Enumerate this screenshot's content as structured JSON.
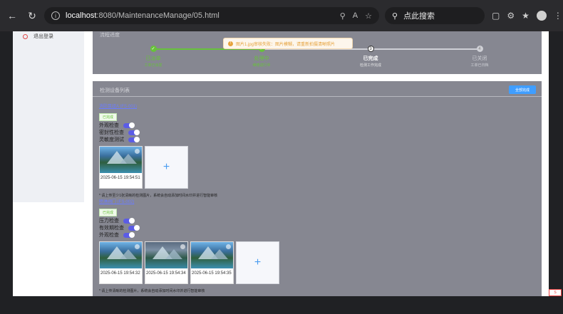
{
  "browser": {
    "url_host": "localhost",
    "url_path": ":8080/MaintenanceManage/05.html",
    "search_placeholder": "点此搜索"
  },
  "sidebar": {
    "logout_label": "退出登录"
  },
  "progress_card": {
    "title": "流程进度",
    "steps": [
      {
        "label": "已派单",
        "sub": "工单已派发",
        "state": "done"
      },
      {
        "label": "处理中",
        "sub": "维修进行中",
        "state": "done"
      },
      {
        "label": "已完成",
        "sub": "检测工作完成",
        "state": "current"
      },
      {
        "label": "已关闭",
        "sub": "工单已归档",
        "state": "pending"
      }
    ],
    "step3_number": "3",
    "step4_number": "4"
  },
  "toast": {
    "message": "图片1.jpg审核失败：图片模糊，请重新拍摄清晰照片"
  },
  "devices_card": {
    "title": "检测设备列表",
    "complete_button": "全部完成",
    "devices": [
      {
        "name": "消防泵组A (FS-001)",
        "status": "已完成",
        "checks": [
          "外观检查",
          "密封性检查",
          "灵敏度测试"
        ],
        "timestamps": [
          "2025-06-15 19:54:51"
        ],
        "hint": "* 请上传至少1张清晰的检测图片，系统会自动添加时间水印并进行智能审核"
      },
      {
        "name": "喷淋阀门 (FS-002)",
        "status": "已完成",
        "checks": [
          "压力检查",
          "有效期检查",
          "外观检查"
        ],
        "timestamps": [
          "2025-06-15 19:54:32",
          "2025-06-15 19:54:34",
          "2025-06-15 19:54:35"
        ],
        "hint": "* 请上传清晰的检测图片，系统会自动添加时间水印并进行智能审核"
      }
    ]
  },
  "colors": {
    "accent": "#409eff",
    "done": "#67c23a",
    "toggle": "#5b5ce6",
    "card_bg": "#868791"
  }
}
